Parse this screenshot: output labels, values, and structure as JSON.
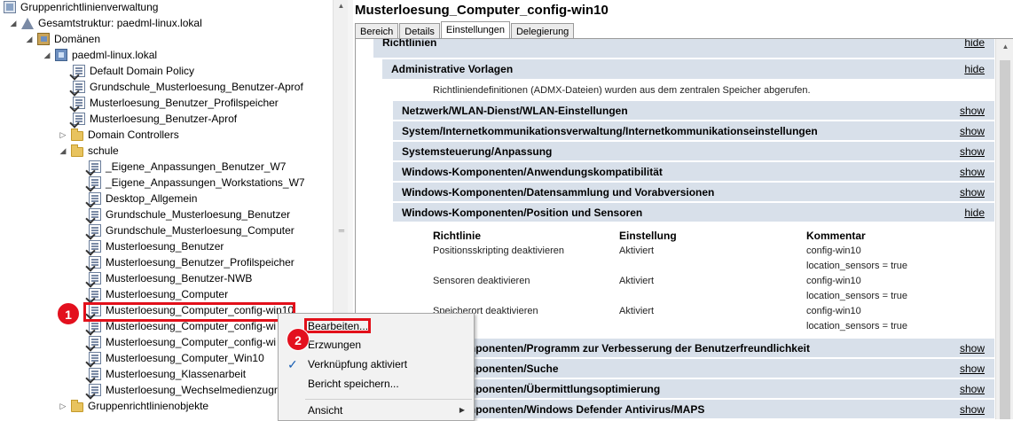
{
  "tree": {
    "rows": [
      {
        "label": "Gruppenrichtlinienverwaltung",
        "icon": "gpm-icon",
        "arrow": ""
      },
      {
        "label": "Gesamtstruktur: paedml-linux.lokal",
        "icon": "forest-icon",
        "arrow": "◢"
      },
      {
        "label": "Domänen",
        "icon": "domains-icon",
        "arrow": "◢"
      },
      {
        "label": "paedml-linux.lokal",
        "icon": "domain-icon",
        "arrow": "◢"
      },
      {
        "label": "Default Domain Policy",
        "icon": "gpo-link-icon",
        "arrow": ""
      },
      {
        "label": "Grundschule_Musterloesung_Benutzer-Aprof",
        "icon": "gpo-link-icon",
        "arrow": ""
      },
      {
        "label": "Musterloesung_Benutzer_Profilspeicher",
        "icon": "gpo-link-icon",
        "arrow": ""
      },
      {
        "label": "Musterloesung_Benutzer-Aprof",
        "icon": "gpo-link-icon",
        "arrow": ""
      },
      {
        "label": "Domain Controllers",
        "icon": "folder-icon",
        "arrow": "▷"
      },
      {
        "label": "schule",
        "icon": "folder-icon",
        "arrow": "◢"
      },
      {
        "label": "_Eigene_Anpassungen_Benutzer_W7",
        "icon": "gpo-link-icon",
        "arrow": ""
      },
      {
        "label": "_Eigene_Anpassungen_Workstations_W7",
        "icon": "gpo-link-icon",
        "arrow": ""
      },
      {
        "label": "Desktop_Allgemein",
        "icon": "gpo-link-icon",
        "arrow": ""
      },
      {
        "label": "Grundschule_Musterloesung_Benutzer",
        "icon": "gpo-link-icon",
        "arrow": ""
      },
      {
        "label": "Grundschule_Musterloesung_Computer",
        "icon": "gpo-link-icon",
        "arrow": ""
      },
      {
        "label": "Musterloesung_Benutzer",
        "icon": "gpo-link-icon",
        "arrow": ""
      },
      {
        "label": "Musterloesung_Benutzer_Profilspeicher",
        "icon": "gpo-link-icon",
        "arrow": ""
      },
      {
        "label": "Musterloesung_Benutzer-NWB",
        "icon": "gpo-link-icon",
        "arrow": ""
      },
      {
        "label": "Musterloesung_Computer",
        "icon": "gpo-link-icon",
        "arrow": ""
      },
      {
        "label": "Musterloesung_Computer_config-win10",
        "icon": "gpo-link-icon",
        "arrow": ""
      },
      {
        "label": "Musterloesung_Computer_config-wi",
        "icon": "gpo-link-icon",
        "arrow": ""
      },
      {
        "label": "Musterloesung_Computer_config-wi",
        "icon": "gpo-link-icon",
        "arrow": ""
      },
      {
        "label": "Musterloesung_Computer_Win10",
        "icon": "gpo-link-icon",
        "arrow": ""
      },
      {
        "label": "Musterloesung_Klassenarbeit",
        "icon": "gpo-link-icon",
        "arrow": ""
      },
      {
        "label": "Musterloesung_Wechselmedienzugri",
        "icon": "gpo-link-icon",
        "arrow": ""
      },
      {
        "label": "Gruppenrichtlinienobjekte",
        "icon": "folder-icon",
        "arrow": "▷"
      }
    ]
  },
  "badges": {
    "one": "1",
    "two": "2"
  },
  "right": {
    "title": "Musterloesung_Computer_config-win10",
    "tabs": [
      "Bereich",
      "Details",
      "Einstellungen",
      "Delegierung"
    ],
    "sections": {
      "richtlinien": {
        "label": "Richtlinien",
        "link": "hide"
      },
      "admin": {
        "label": "Administrative Vorlagen",
        "link": "hide"
      },
      "admx_note": "Richtliniendefinitionen (ADMX-Dateien) wurden aus dem zentralen Speicher abgerufen.",
      "categories": [
        {
          "label": "Netzwerk/WLAN-Dienst/WLAN-Einstellungen",
          "link": "show"
        },
        {
          "label": "System/Internetkommunikationsverwaltung/Internetkommunikationseinstellungen",
          "link": "show"
        },
        {
          "label": "Systemsteuerung/Anpassung",
          "link": "show"
        },
        {
          "label": "Windows-Komponenten/Anwendungskompatibilität",
          "link": "show"
        },
        {
          "label": "Windows-Komponenten/Datensammlung und Vorabversionen",
          "link": "show"
        },
        {
          "label": "Windows-Komponenten/Position und Sensoren",
          "link": "hide"
        }
      ],
      "table": {
        "headers": [
          "Richtlinie",
          "Einstellung",
          "Kommentar"
        ],
        "rows": [
          {
            "policy": "Positionsskripting deaktivieren",
            "setting": "Aktiviert",
            "comment1": "config-win10",
            "comment2": "location_sensors = true"
          },
          {
            "policy": "Sensoren deaktivieren",
            "setting": "Aktiviert",
            "comment1": "config-win10",
            "comment2": "location_sensors = true"
          },
          {
            "policy": "Speicherort deaktivieren",
            "setting": "Aktiviert",
            "comment1": "config-win10",
            "comment2": "location_sensors = true"
          }
        ]
      },
      "more_categories": [
        {
          "label": "Windows-Komponenten/Programm zur Verbesserung der Benutzerfreundlichkeit",
          "link": "show"
        },
        {
          "label": "Windows-Komponenten/Suche",
          "link": "show"
        },
        {
          "label": "Windows-Komponenten/Übermittlungsoptimierung",
          "link": "show"
        },
        {
          "label": "Windows-Komponenten/Windows Defender Antivirus/MAPS",
          "link": "show"
        }
      ]
    }
  },
  "context_menu": {
    "items": [
      {
        "label": "Bearbeiten..."
      },
      {
        "label": "Erzwungen"
      },
      {
        "label": "Verknüpfung aktiviert",
        "checked": "✓"
      },
      {
        "label": "Bericht speichern..."
      },
      {
        "label": "Ansicht",
        "submenu": "▶"
      }
    ]
  },
  "colors": {
    "highlight_red": "#e2101a",
    "section_header": "#d8e0ea"
  }
}
